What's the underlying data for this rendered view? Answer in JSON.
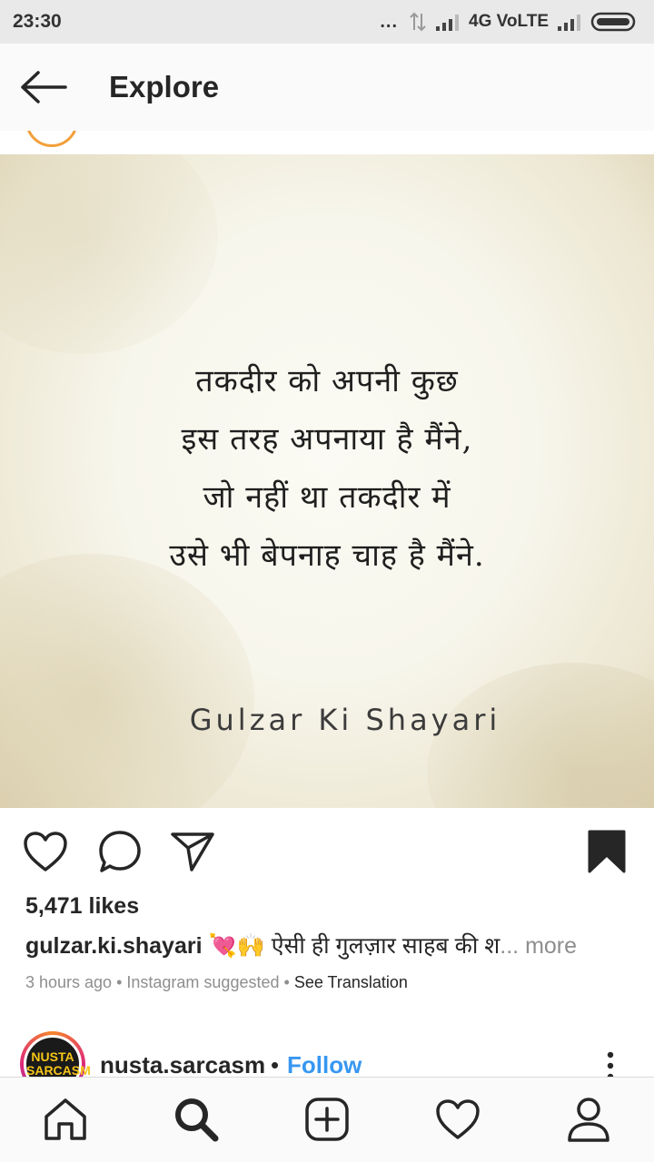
{
  "status_bar": {
    "time": "23:30",
    "dots": "...",
    "network": "4G VoLTE",
    "icons": [
      "data-arrows-icon",
      "signal-icon",
      "signal-icon-2",
      "battery-icon"
    ]
  },
  "header": {
    "title": "Explore",
    "back_icon": "back-arrow-icon"
  },
  "post": {
    "image_text": {
      "lines": [
        "तकदीर को अपनी कुछ",
        "इस तरह अपनाया है मैंने,",
        "जो नहीं था तकदीर में",
        "उसे भी बेपनाह चाह है मैंने."
      ],
      "signature": "Gulzar Ki Shayari"
    },
    "actions": [
      "heart-icon",
      "comment-icon",
      "share-icon",
      "bookmark-icon"
    ],
    "likes": "5,471 likes",
    "caption": {
      "username": "gulzar.ki.shayari",
      "emoji": "💘🙌",
      "text": " ऐसी ही गुलज़ार साहब की श",
      "more": "... more"
    },
    "meta": {
      "time": "3 hours ago",
      "sep1": " • ",
      "suggested": "Instagram suggested",
      "sep2": " • ",
      "translate": "See Translation"
    }
  },
  "next_post": {
    "avatar_text_1": "NUSTA",
    "avatar_text_2": "SARCASM",
    "username": "nusta.sarcasm",
    "dot": "•",
    "follow": "Follow"
  },
  "bottom_nav": [
    "home-icon",
    "search-icon",
    "add-post-icon",
    "activity-heart-icon",
    "profile-icon"
  ]
}
